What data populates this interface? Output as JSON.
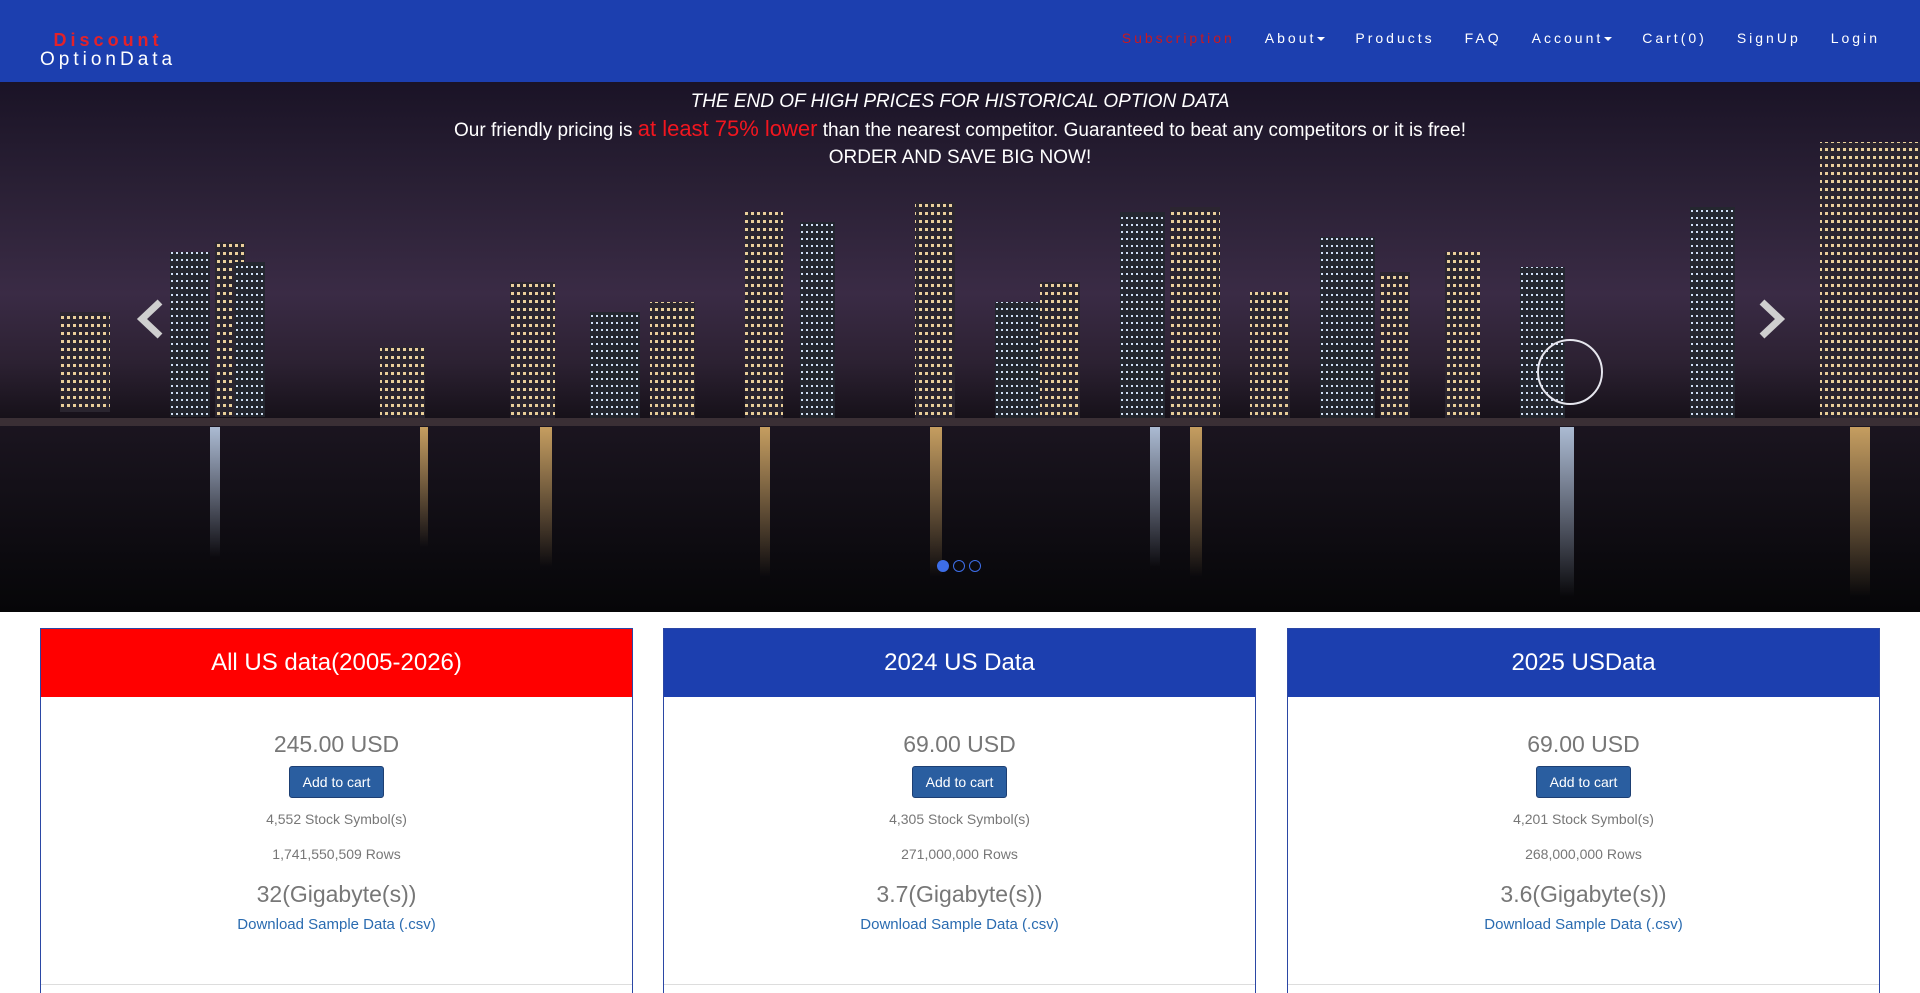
{
  "brand": {
    "line1": "Discount",
    "line2": "OptionData"
  },
  "nav": {
    "items": [
      {
        "label": "Subscription",
        "active": true,
        "dropdown": false
      },
      {
        "label": "About",
        "active": false,
        "dropdown": true
      },
      {
        "label": "Products",
        "active": false,
        "dropdown": false
      },
      {
        "label": "FAQ",
        "active": false,
        "dropdown": false
      },
      {
        "label": "Account",
        "active": false,
        "dropdown": true
      },
      {
        "label": "Cart(0)",
        "active": false,
        "dropdown": false
      },
      {
        "label": "SignUp",
        "active": false,
        "dropdown": false
      },
      {
        "label": "Login",
        "active": false,
        "dropdown": false
      }
    ]
  },
  "hero": {
    "headline": "THE END OF HIGH PRICES FOR HISTORICAL OPTION DATA",
    "pricing_prefix": "Our friendly pricing is",
    "pricing_highlight": "at least 75% lower",
    "pricing_suffix": "than the nearest competitor. Guaranteed to beat any competitors or it is free!",
    "cta": "ORDER AND SAVE BIG NOW!",
    "prev_icon": "chevron-left-icon",
    "next_icon": "chevron-right-icon",
    "slide_count": 3,
    "active_slide": 1
  },
  "cards": [
    {
      "title": "All US data(2005-2026)",
      "header_color": "#ff0000",
      "price": "245.00 USD",
      "button": "Add to cart",
      "symbols": "4,552 Stock Symbol(s)",
      "rows": "1,741,550,509 Rows",
      "size": "32(Gigabyte(s))",
      "download": "Download Sample Data (.csv)"
    },
    {
      "title": "2024 US Data",
      "header_color": "#1c3faf",
      "price": "69.00 USD",
      "button": "Add to cart",
      "symbols": "4,305 Stock Symbol(s)",
      "rows": "271,000,000 Rows",
      "size": "3.7(Gigabyte(s))",
      "download": "Download Sample Data (.csv)"
    },
    {
      "title": "2025 USData",
      "header_color": "#1c3faf",
      "price": "69.00 USD",
      "button": "Add to cart",
      "symbols": "4,201 Stock Symbol(s)",
      "rows": "268,000,000 Rows",
      "size": "3.6(Gigabyte(s))",
      "download": "Download Sample Data (.csv)"
    }
  ],
  "colors": {
    "navbar": "#1c3faf",
    "brand_accent": "#e3222a",
    "active_nav": "#c9181f",
    "highlight": "#f2161f",
    "button": "#2a5ea0",
    "link": "#2a6bb0"
  }
}
